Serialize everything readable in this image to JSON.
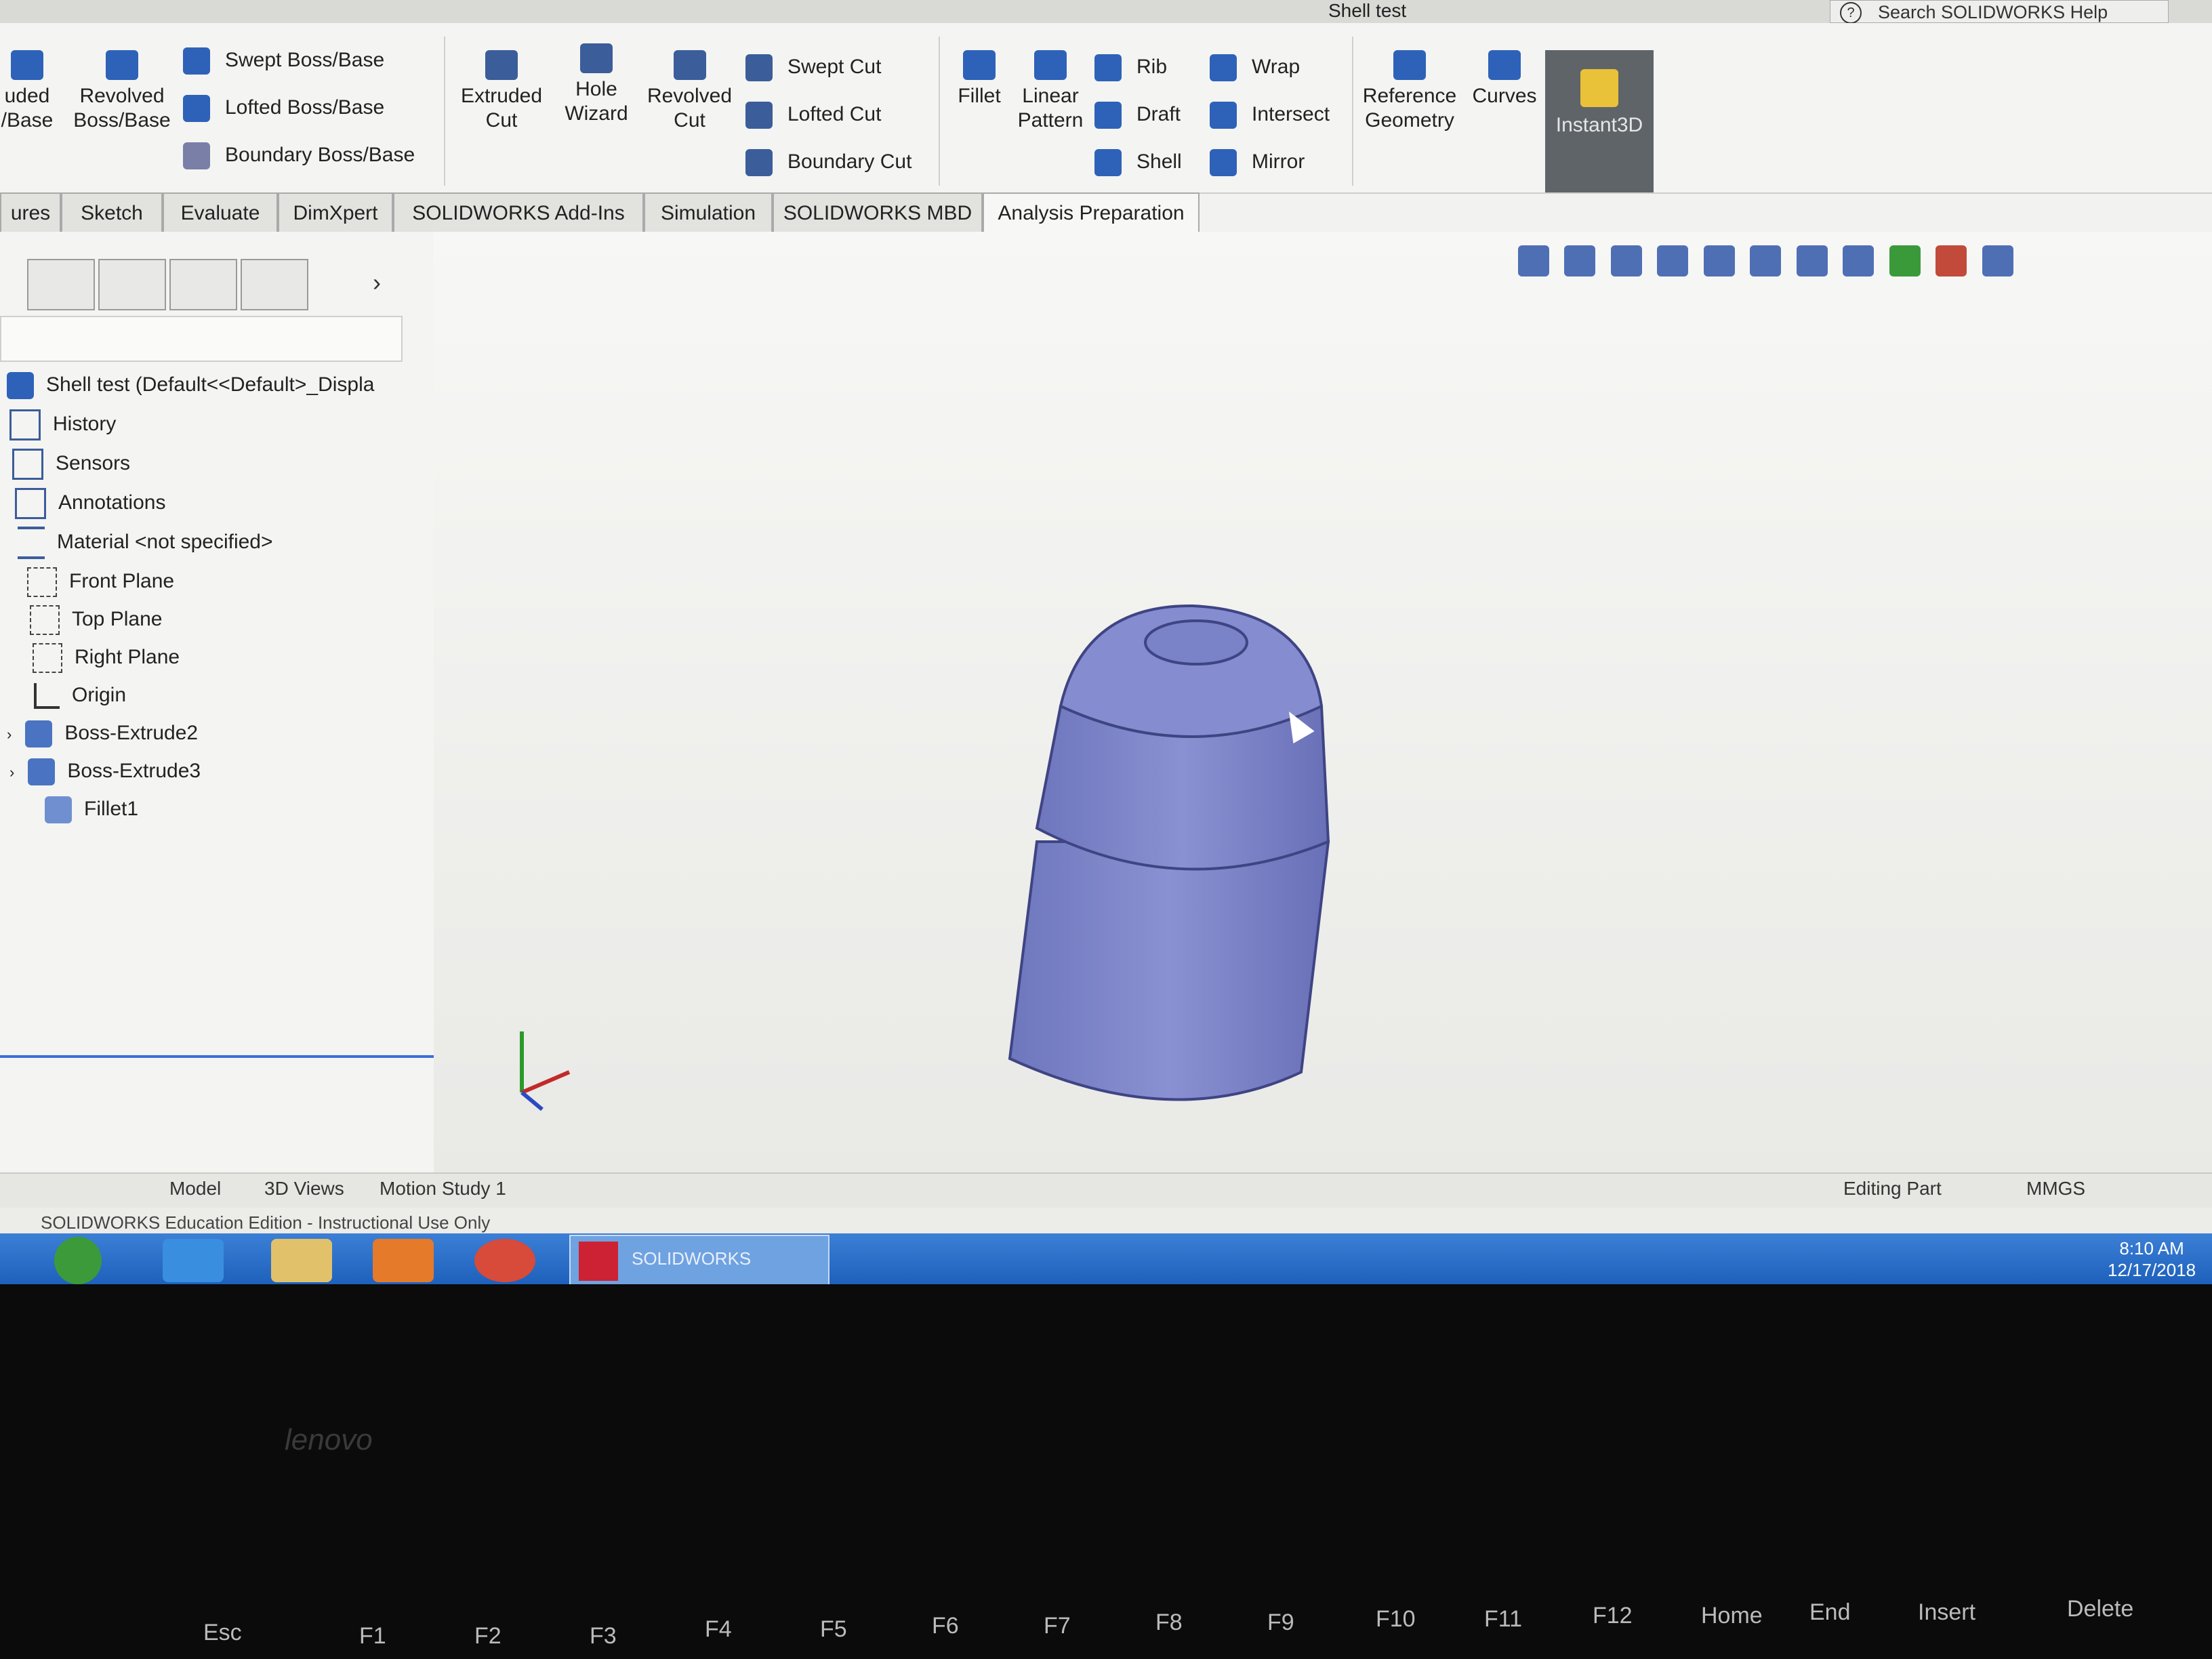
{
  "window": {
    "title": "Shell test",
    "help_placeholder": "Search SOLIDWORKS Help",
    "help_icon": "?"
  },
  "ribbon": {
    "extruded_base": "uded\n/Base",
    "revolved_base": "Revolved\nBoss/Base",
    "swept_boss": "Swept Boss/Base",
    "lofted_boss": "Lofted Boss/Base",
    "boundary_boss": "Boundary Boss/Base",
    "extruded_cut": "Extruded\nCut",
    "hole_wizard": "Hole\nWizard",
    "revolved_cut": "Revolved\nCut",
    "swept_cut": "Swept Cut",
    "lofted_cut": "Lofted Cut",
    "boundary_cut": "Boundary Cut",
    "fillet": "Fillet",
    "linear_pattern": "Linear\nPattern",
    "rib": "Rib",
    "draft": "Draft",
    "shell": "Shell",
    "wrap": "Wrap",
    "intersect": "Intersect",
    "mirror": "Mirror",
    "reference_geometry": "Reference\nGeometry",
    "curves": "Curves",
    "instant3d": "Instant3D"
  },
  "tabs": [
    "ures",
    "Sketch",
    "Evaluate",
    "DimXpert",
    "SOLIDWORKS Add-Ins",
    "Simulation",
    "SOLIDWORKS MBD",
    "Analysis Preparation"
  ],
  "tree": [
    {
      "label": "Shell test  (Default<<Default>_Displa",
      "icon": "part-icon"
    },
    {
      "label": "History",
      "icon": "history-icon"
    },
    {
      "label": "Sensors",
      "icon": "sensors-icon"
    },
    {
      "label": "Annotations",
      "icon": "annotations-icon"
    },
    {
      "label": "Material <not specified>",
      "icon": "material-icon"
    },
    {
      "label": "Front Plane",
      "icon": "plane-icon"
    },
    {
      "label": "Top Plane",
      "icon": "plane-icon"
    },
    {
      "label": "Right Plane",
      "icon": "plane-icon"
    },
    {
      "label": "Origin",
      "icon": "origin-icon"
    },
    {
      "label": "Boss-Extrude2",
      "icon": "extrude-icon"
    },
    {
      "label": "Boss-Extrude3",
      "icon": "extrude-icon"
    },
    {
      "label": "Fillet1",
      "icon": "fillet-icon"
    }
  ],
  "bottom_tabs": [
    "Model",
    "3D Views",
    "Motion Study 1"
  ],
  "status": {
    "edition": "SOLIDWORKS Education Edition - Instructional Use Only",
    "mode": "Editing Part",
    "units": "MMGS"
  },
  "taskbar": {
    "sw_label": "SOLIDWORKS",
    "time": "8:10 AM",
    "date": "12/17/2018"
  },
  "laptop": {
    "brand": "lenovo",
    "keys": [
      "Esc",
      "F1",
      "F2",
      "F3",
      "F4",
      "F5",
      "F6",
      "F7",
      "F8",
      "F9",
      "F10",
      "F11",
      "F12",
      "Home",
      "End",
      "Insert",
      "Delete"
    ]
  },
  "colors": {
    "model": "#7f86c9",
    "model_dark": "#5b60a8",
    "accent": "#3a6fd8",
    "taskbar": "#2a6fca"
  }
}
